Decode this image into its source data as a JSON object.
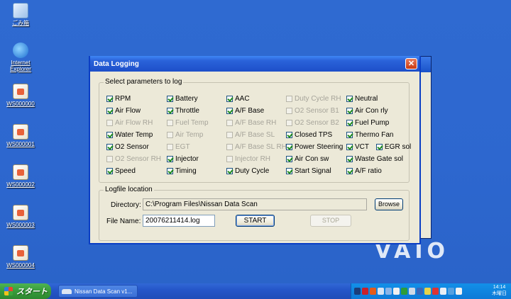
{
  "desktop": {
    "icons": [
      {
        "label": "ごみ箱"
      },
      {
        "label": "Internet Explorer"
      },
      {
        "label": "WS000000"
      },
      {
        "label": "WS000001"
      },
      {
        "label": "WS000002"
      },
      {
        "label": "WS000003"
      },
      {
        "label": "WS000004"
      }
    ],
    "wallpaper_logo": "VAIO"
  },
  "dialog": {
    "title": "Data Logging",
    "close_glyph": "✕",
    "params_group_label": "Select parameters to log",
    "params": [
      {
        "label": "RPM",
        "checked": true,
        "enabled": true
      },
      {
        "label": "Battery",
        "checked": true,
        "enabled": true
      },
      {
        "label": "AAC",
        "checked": true,
        "enabled": true
      },
      {
        "label": "Duty Cycle RH",
        "checked": false,
        "enabled": false
      },
      {
        "label": "Neutral",
        "checked": true,
        "enabled": true
      },
      {
        "label": "Air Flow",
        "checked": true,
        "enabled": true
      },
      {
        "label": "Throttle",
        "checked": true,
        "enabled": true
      },
      {
        "label": "A/F Base",
        "checked": true,
        "enabled": true
      },
      {
        "label": "O2 Sensor B1",
        "checked": false,
        "enabled": false
      },
      {
        "label": "Air Con rly",
        "checked": true,
        "enabled": true
      },
      {
        "label": "Air Flow RH",
        "checked": false,
        "enabled": false
      },
      {
        "label": "Fuel Temp",
        "checked": false,
        "enabled": false
      },
      {
        "label": "A/F Base RH",
        "checked": false,
        "enabled": false
      },
      {
        "label": "O2 Sensor B2",
        "checked": false,
        "enabled": false
      },
      {
        "label": "Fuel Pump",
        "checked": true,
        "enabled": true
      },
      {
        "label": "Water Temp",
        "checked": true,
        "enabled": true
      },
      {
        "label": "Air Temp",
        "checked": false,
        "enabled": false
      },
      {
        "label": "A/F Base SL",
        "checked": false,
        "enabled": false
      },
      {
        "label": "Closed TPS",
        "checked": true,
        "enabled": true
      },
      {
        "label": "Thermo Fan",
        "checked": true,
        "enabled": true
      },
      {
        "label": "O2 Sensor",
        "checked": true,
        "enabled": true
      },
      {
        "label": "EGT",
        "checked": false,
        "enabled": false
      },
      {
        "label": "A/F Base SL RH",
        "checked": false,
        "enabled": false
      },
      {
        "label": "Power Steering",
        "checked": true,
        "enabled": true
      },
      {
        "label": "VCT",
        "checked": true,
        "enabled": true
      },
      {
        "label": "EGR sol",
        "checked": true,
        "enabled": true
      },
      {
        "label": "O2 Sensor RH",
        "checked": false,
        "enabled": false
      },
      {
        "label": "Injector",
        "checked": true,
        "enabled": true
      },
      {
        "label": "Injector RH",
        "checked": false,
        "enabled": false
      },
      {
        "label": "Air Con sw",
        "checked": true,
        "enabled": true
      },
      {
        "label": "Waste Gate sol",
        "checked": true,
        "enabled": true
      },
      {
        "label": "Speed",
        "checked": true,
        "enabled": true
      },
      {
        "label": "Timing",
        "checked": true,
        "enabled": true
      },
      {
        "label": "Duty Cycle",
        "checked": true,
        "enabled": true
      },
      {
        "label": "Start Signal",
        "checked": true,
        "enabled": true
      },
      {
        "label": "A/F ratio",
        "checked": true,
        "enabled": true
      }
    ],
    "logfile": {
      "group_label": "Logfile location",
      "directory_label": "Directory:",
      "directory_value": "C:\\Program Files\\Nissan Data Scan",
      "browse_label": "Browse",
      "filename_label": "File Name:",
      "filename_value": "20076211414.log",
      "start_label": "START",
      "stop_label": "STOP"
    }
  },
  "taskbar": {
    "start_label": "スタート",
    "task_label": "Nissan Data Scan v1...",
    "clock_time": "14:14",
    "clock_day": "木曜日"
  },
  "colors": {
    "desktop": "#2d67cf",
    "titlebar": "#2a62d9",
    "dialog_face": "#ece9d8",
    "start_green": "#379b3a",
    "check_green": "#1d8a1d"
  }
}
